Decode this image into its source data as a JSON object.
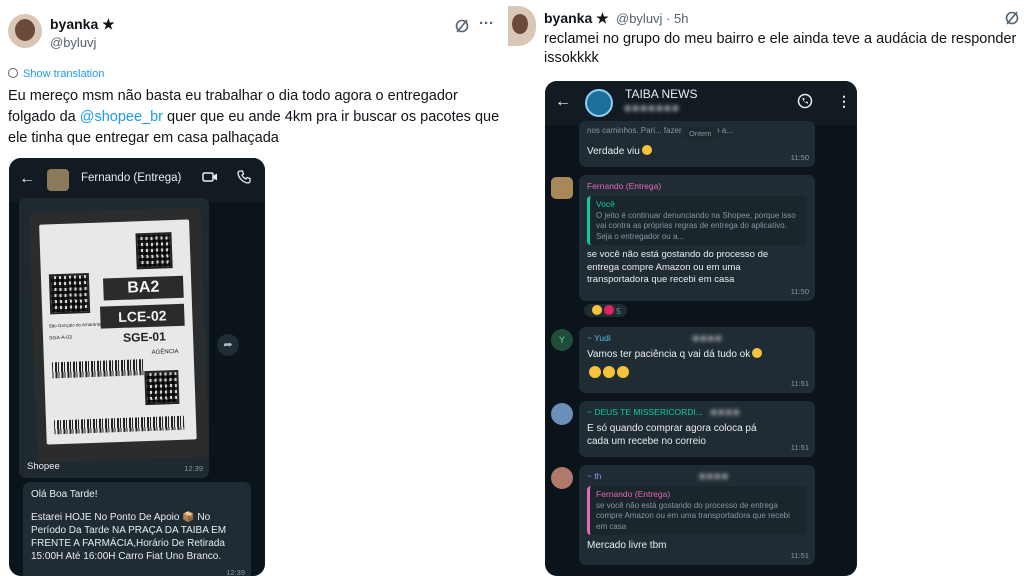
{
  "left_tweet": {
    "author_name": "byanka ★",
    "handle": "@byluvj",
    "show_translation": "Show translation",
    "text_before": "Eu mereço msm não basta eu trabalhar o dia todo agora o entregador folgado da ",
    "mention": "@shopee_br",
    "text_after": " quer que eu ande 4km pra ir buscar os pacotes que ele tinha que entregar em casa palhaçada",
    "phone": {
      "contact": "Fernando (Entrega)",
      "label_codes": {
        "code1": "BA2",
        "code2": "LCE-02",
        "code3": "SGE-01",
        "small1": "SGA-A-03",
        "small2": "AGÊNCIA",
        "small3": "São Gonçalo do Amarante"
      },
      "image_caption": "Shopee",
      "image_time": "12:39",
      "message": {
        "line1": "Olá Boa Tarde!",
        "line2": "Estarei HOJE No Ponto De Apoio 📦 No Período Da Tarde NA PRAÇA DA TAIBA EM FRENTE A FARMÁCIA,Horário De Retirada 15:00H Até 16:00H Carro Fiat Uno Branco.",
        "time": "12:39"
      }
    }
  },
  "right_tweet": {
    "author_name": "byanka ★",
    "handle": "@byluvj",
    "age": "· 5h",
    "text": "reclamei no grupo do meu bairro e ele ainda teve a audácia de responder issokkkk",
    "phone": {
      "group_name": "TAIBA NEWS",
      "group_subtitle": "",
      "msg1": {
        "partial": "nos caminhos. Pari... fazer o bem e o a...",
        "text": "Verdade viu",
        "time": "11:50",
        "date_chip": "Ontem"
      },
      "msg2": {
        "sender": "Fernando (Entrega)",
        "quote_name": "Você",
        "quote_text": "O jeito é continuar denunciando na Shopee, porque isso vai contra as próprias regras de entrega do aplicativo. Seja o entregador ou a...",
        "text": "se você não está gostando do processo de entrega  compre Amazon ou em uma transportadora que recebi em casa",
        "time": "11:50",
        "reactions": "5"
      },
      "msg3": {
        "sender": "~ Yudi",
        "avatar_letter": "Y",
        "text": "Vamos ter paciência q vai dá tudo ok",
        "time": "11:51"
      },
      "msg4": {
        "sender": "~ DEUS TE MISSERICORDI...",
        "text": "E só quando comprar agora coloca pá cada um recebe no correio",
        "time": "11:51"
      },
      "msg5": {
        "sender": "~ th",
        "quote_name": "Fernando (Entrega)",
        "quote_text": "se você não está gostando do processo de entrega  compre Amazon ou em uma transportadora que recebi em casa",
        "text": "Mercado livre tbm",
        "time": "11:51"
      }
    }
  },
  "colors": {
    "link": "#1d9bf0",
    "wa_bg": "#0b141a",
    "wa_bubble": "#202c33",
    "wa_accent": "#06cf9c"
  },
  "icons": [
    "grok-icon",
    "more-icon",
    "translate-icon",
    "back-arrow-icon",
    "video-call-icon",
    "phone-call-icon",
    "forward-icon",
    "menu-icon"
  ]
}
